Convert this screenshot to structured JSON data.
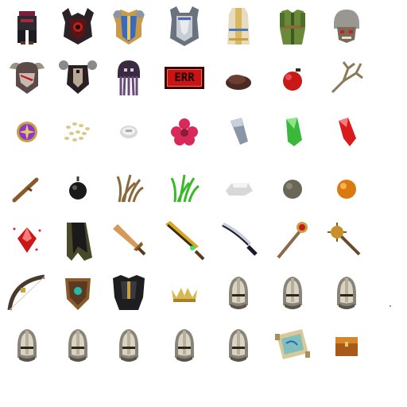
{
  "sprite_sheet": {
    "error_placeholder_label": "ERR",
    "rows": [
      [
        "dark-tunic-icon",
        "demon-chest-armor-icon",
        "blue-gold-chest-armor-icon",
        "silver-plate-armor-icon",
        "white-gold-robe-icon",
        "green-robe-icon",
        "orc-helmet-icon"
      ],
      [
        "horned-skull-helmet-icon",
        "dark-shield-armor-icon",
        "purple-tentacle-hood-icon",
        "error-placeholder-icon",
        "dirt-mound-icon",
        "red-berry-icon",
        "dry-root-icon"
      ],
      [
        "gold-purple-amulet-icon",
        "seeds-icon",
        "silver-coin-icon",
        "red-flower-icon",
        "iron-shard-icon",
        "green-crystal-icon",
        "red-crystal-icon"
      ],
      [
        "wooden-stick-icon",
        "black-bomb-icon",
        "dry-grass-icon",
        "green-grass-icon",
        "white-stone-icon",
        "grey-rock-icon",
        "orange-orb-icon"
      ],
      [
        "red-gem-icon",
        "dark-cape-icon",
        "bronze-sword-icon",
        "golden-dragon-blade-icon",
        "dark-curved-blade-icon",
        "ruby-staff-icon",
        "spiked-mace-icon"
      ],
      [
        "recurve-bow-icon",
        "ornate-shield-icon",
        "black-heavy-armor-icon",
        "golden-crown-icon",
        "knight-helmet-icon",
        "knight-helmet-icon",
        "knight-helmet-icon"
      ],
      [
        "knight-helmet-icon",
        "knight-helmet-icon",
        "knight-helmet-icon",
        "knight-helmet-icon",
        "knight-helmet-icon",
        "magic-scroll-icon",
        "treasure-chest-icon"
      ]
    ]
  }
}
